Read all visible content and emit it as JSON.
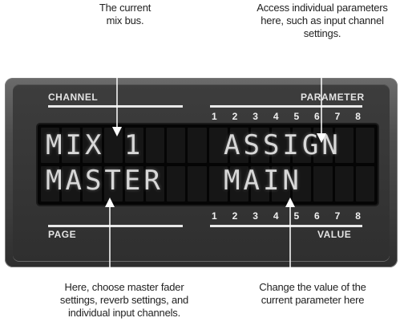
{
  "callouts": {
    "mix_bus": [
      "The current",
      "mix bus."
    ],
    "access": [
      "Access individual parameters",
      "here, such as input channel",
      "settings."
    ],
    "page": [
      "Here, choose master fader",
      "settings, reverb settings, and",
      "individual input channels."
    ],
    "value": [
      "Change the value of the",
      "current parameter here"
    ]
  },
  "panel": {
    "channel_label": "CHANNEL",
    "parameter_label": "PARAMETER",
    "page_label": "PAGE",
    "value_label": "VALUE",
    "top_numbers": [
      "1",
      "2",
      "3",
      "4",
      "5",
      "6",
      "7",
      "8"
    ],
    "bottom_numbers": [
      "1",
      "2",
      "3",
      "4",
      "5",
      "6",
      "7",
      "8"
    ]
  },
  "display": {
    "channel_line1": "MIX 1",
    "channel_line2": "MASTER",
    "parameter_line1": "ASSIGN",
    "parameter_line2": "MAIN"
  }
}
